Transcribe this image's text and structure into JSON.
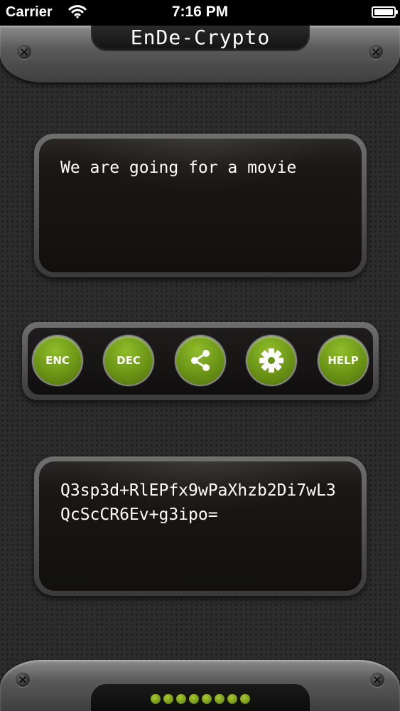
{
  "status_bar": {
    "carrier": "Carrier",
    "time": "7:16 PM",
    "battery_level": 1.0,
    "icons": [
      "wifi-icon",
      "battery-icon"
    ]
  },
  "header": {
    "title": "EnDe-Crypto"
  },
  "input": {
    "text": "We are going for a movie"
  },
  "toolbar": {
    "enc_label": "ENC",
    "dec_label": "DEC",
    "share_icon": "share-icon",
    "settings_icon": "gear-icon",
    "help_label": "HELP"
  },
  "output": {
    "text": "Q3sp3d+RlEPfx9wPaXhzb2Di7wL3QcScCR6Ev+g3ipo="
  },
  "pager": {
    "dot_count": 8
  },
  "colors": {
    "accent": "#6b9416",
    "panel": "#120f0f",
    "text": "#ffffff"
  }
}
